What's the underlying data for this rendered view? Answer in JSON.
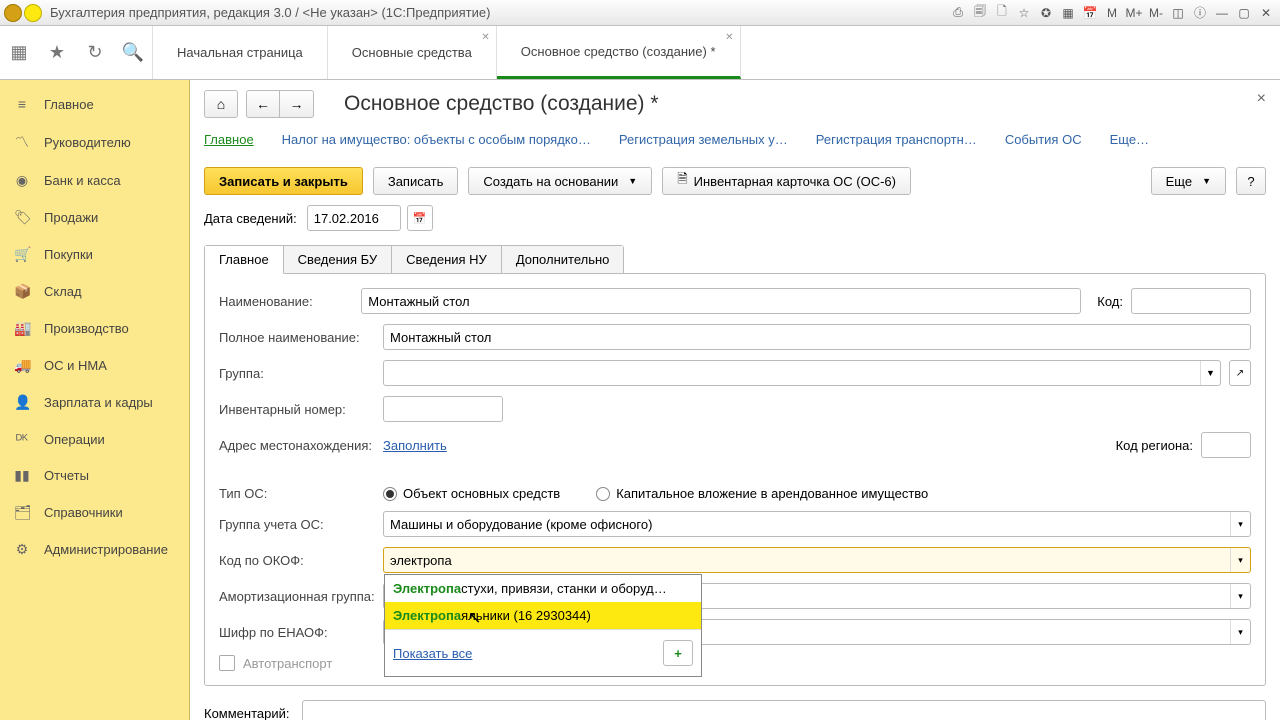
{
  "titlebar": {
    "title": "Бухгалтерия предприятия, редакция 3.0 / <Не указан> (1С:Предприятие)"
  },
  "maintabs": {
    "t0": "Начальная страница",
    "t1": "Основные средства",
    "t2": "Основное средство (создание) *"
  },
  "sidebar": {
    "i0": "Главное",
    "i1": "Руководителю",
    "i2": "Банк и касса",
    "i3": "Продажи",
    "i4": "Покупки",
    "i5": "Склад",
    "i6": "Производство",
    "i7": "ОС и НМА",
    "i8": "Зарплата и кадры",
    "i9": "Операции",
    "i10": "Отчеты",
    "i11": "Справочники",
    "i12": "Администрирование"
  },
  "page": {
    "title": "Основное средство (создание) *",
    "subtabs": {
      "t0": "Главное",
      "t1": "Налог на имущество: объекты с особым порядко…",
      "t2": "Регистрация земельных у…",
      "t3": "Регистрация транспортн…",
      "t4": "События ОС",
      "t5": "Еще…"
    },
    "cmd": {
      "save_close": "Записать и закрыть",
      "save": "Записать",
      "create_based": "Создать на основании",
      "card": "Инвентарная карточка ОС (ОС-6)",
      "more": "Еще",
      "help": "?"
    },
    "date_label": "Дата сведений:",
    "date_value": "17.02.2016",
    "formtabs": {
      "t0": "Главное",
      "t1": "Сведения БУ",
      "t2": "Сведения НУ",
      "t3": "Дополнительно"
    },
    "f": {
      "name_l": "Наименование:",
      "name_v": "Монтажный стол",
      "fullname_l": "Полное наименование:",
      "fullname_v": "Монтажный стол",
      "group_l": "Группа:",
      "invnum_l": "Инвентарный номер:",
      "addr_l": "Адрес местонахождения:",
      "addr_link": "Заполнить",
      "code_l": "Код:",
      "region_l": "Код региона:",
      "type_l": "Тип ОС:",
      "type_r0": "Объект основных средств",
      "type_r1": "Капитальное вложение в арендованное имущество",
      "acctgroup_l": "Группа учета ОС:",
      "acctgroup_v": "Машины и оборудование (кроме офисного)",
      "okof_l": "Код по ОКОФ:",
      "okof_v": "электропа",
      "amort_l": "Амортизационная группа:",
      "enaof_l": "Шифр по ЕНАОФ:",
      "auto_l": "Автотранспорт",
      "comment_l": "Комментарий:"
    },
    "dropdown": {
      "i0_pre": "Электропа",
      "i0_rest": "стухи, привязи, станки и оборуд…",
      "i1_pre": "Электропа",
      "i1_rest": "яльники (16 2930344)",
      "show_all": "Показать все"
    }
  }
}
